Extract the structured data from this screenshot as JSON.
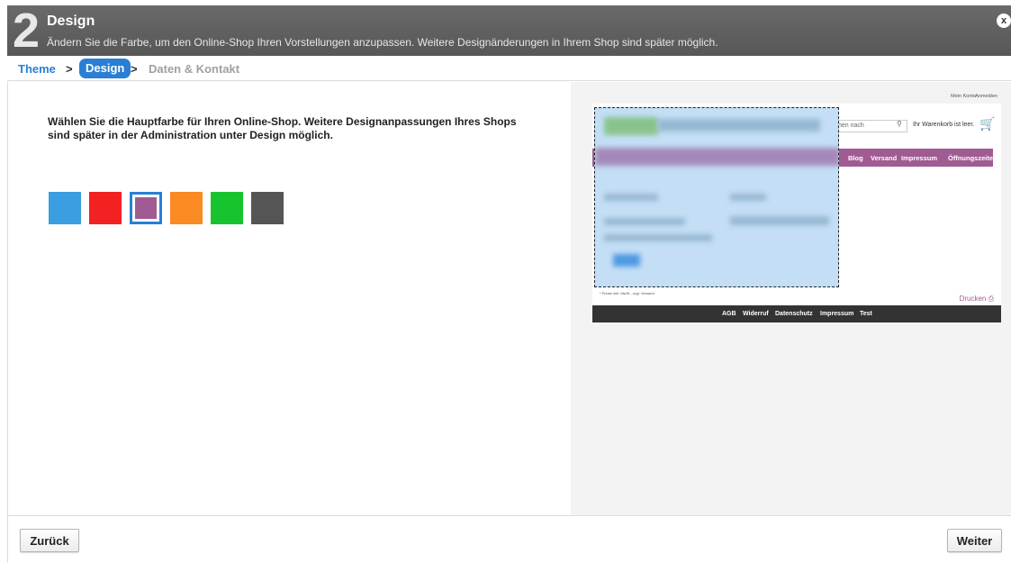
{
  "header": {
    "step_number": "2",
    "title": "Design",
    "description": "Ändern Sie die Farbe, um den Online-Shop Ihren Vorstellungen anzupassen. Weitere Designänderungen in Ihrem Shop sind später möglich.",
    "close_label": "x"
  },
  "breadcrumb": {
    "theme": "Theme",
    "sep": ">",
    "design": "Design",
    "daten": "Daten & Kontakt"
  },
  "main": {
    "instruction": "Wählen Sie die Hauptfarbe für Ihren Online-Shop. Weitere Designanpassungen Ihres Shops sind später in der Administration unter Design möglich.",
    "swatches": [
      {
        "color": "#3a9ee0",
        "name": "blue"
      },
      {
        "color": "#f22222",
        "name": "red"
      },
      {
        "color": "#a05b93",
        "name": "purple",
        "selected": true
      },
      {
        "color": "#fa8a22",
        "name": "orange"
      },
      {
        "color": "#18c42e",
        "name": "green"
      },
      {
        "color": "#555555",
        "name": "gray"
      }
    ],
    "selected_border": "#2a7fd4"
  },
  "preview": {
    "top_links": {
      "konto": "Mein Konto",
      "anmelden": "Anmelden"
    },
    "search_placeholder": "hen nach",
    "cart_text": "Ihr Warenkorb ist leer.",
    "nav": [
      "Blog",
      "Versand",
      "Impressum",
      "Öffnungszeite"
    ],
    "price_note": "* Preise inkl. MwSt., zzgl. Versand",
    "print_label": "Drucken",
    "footer": [
      "AGB",
      "Widerruf",
      "Datenschutz",
      "Impressum",
      "Test"
    ],
    "accent": "#a05b93"
  },
  "footer": {
    "back_label": "Zurück",
    "next_label": "Weiter"
  }
}
